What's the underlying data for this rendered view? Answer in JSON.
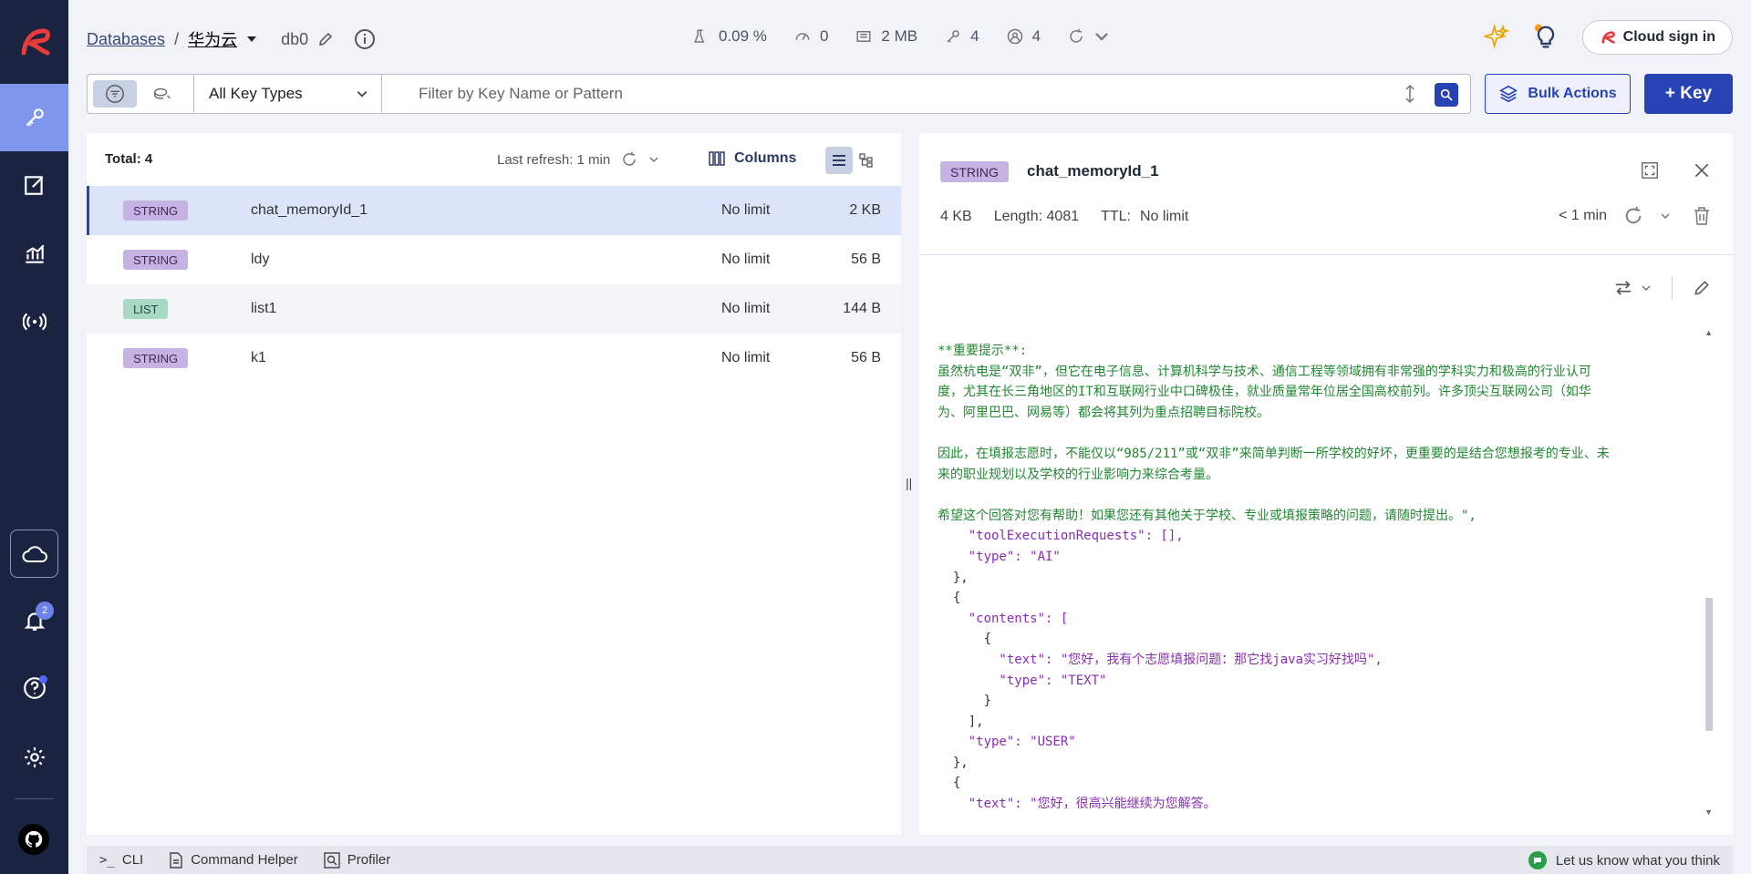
{
  "sidebar": {
    "notifications_count": "2"
  },
  "header": {
    "breadcrumb_root": "Databases",
    "breadcrumb_sep": "/",
    "database_name": "华为云",
    "db_index": "db0",
    "stats": {
      "cpu": "0.09 %",
      "ops": "0",
      "memory": "2 MB",
      "keys": "4",
      "clients": "4"
    },
    "cloud_signin_label": "Cloud sign in"
  },
  "filter": {
    "key_type": "All Key Types",
    "placeholder": "Filter by Key Name or Pattern",
    "bulk_actions_label": "Bulk Actions",
    "add_key_label": "+ Key"
  },
  "key_list": {
    "total_label": "Total: 4",
    "last_refresh": "Last refresh: 1 min",
    "columns_label": "Columns",
    "rows": [
      {
        "type": "STRING",
        "name": "chat_memoryId_1",
        "ttl": "No limit",
        "size": "2 KB"
      },
      {
        "type": "STRING",
        "name": "ldy",
        "ttl": "No limit",
        "size": "56 B"
      },
      {
        "type": "LIST",
        "name": "list1",
        "ttl": "No limit",
        "size": "144 B"
      },
      {
        "type": "STRING",
        "name": "k1",
        "ttl": "No limit",
        "size": "56 B"
      }
    ]
  },
  "detail": {
    "type": "STRING",
    "key_name": "chat_memoryId_1",
    "size": "4 KB",
    "length": "Length: 4081",
    "ttl_label": "TTL:",
    "ttl_value": "No limit",
    "refresh_age": "< 1 min",
    "lines": [
      "**重要提示**:",
      "虽然杭电是“双非”，但它在电子信息、计算机科学与技术、通信工程等领域拥有非常强的学科实力和极高的行业认可",
      "度，尤其在长三角地区的IT和互联网行业中口碑极佳，就业质量常年位居全国高校前列。许多顶尖互联网公司（如华",
      "为、阿里巴巴、网易等）都会将其列为重点招聘目标院校。",
      "",
      "因此，在填报志愿时，不能仅以“985/211”或“双非”来简单判断一所学校的好坏，更重要的是结合您想报考的专业、未",
      "来的职业规划以及学校的行业影响力来综合考量。",
      "",
      "希望这个回答对您有帮助！如果您还有其他关于学校、专业或填报策略的问题，请随时提出。\",",
      "    \"toolExecutionRequests\": [],",
      "    \"type\": \"AI\"",
      "  },",
      "  {",
      "    \"contents\": [",
      "      {",
      "        \"text\": \"您好，我有个志愿填报问题：那它找java实习好找吗\",",
      "        \"type\": \"TEXT\"",
      "      }",
      "    ],",
      "    \"type\": \"USER\"",
      "  },",
      "  {",
      "    \"text\": \"您好，很高兴能继续为您解答。"
    ]
  },
  "footer": {
    "cli_label": "CLI",
    "command_helper_label": "Command Helper",
    "profiler_label": "Profiler",
    "feedback_label": "Let us know what you think"
  }
}
